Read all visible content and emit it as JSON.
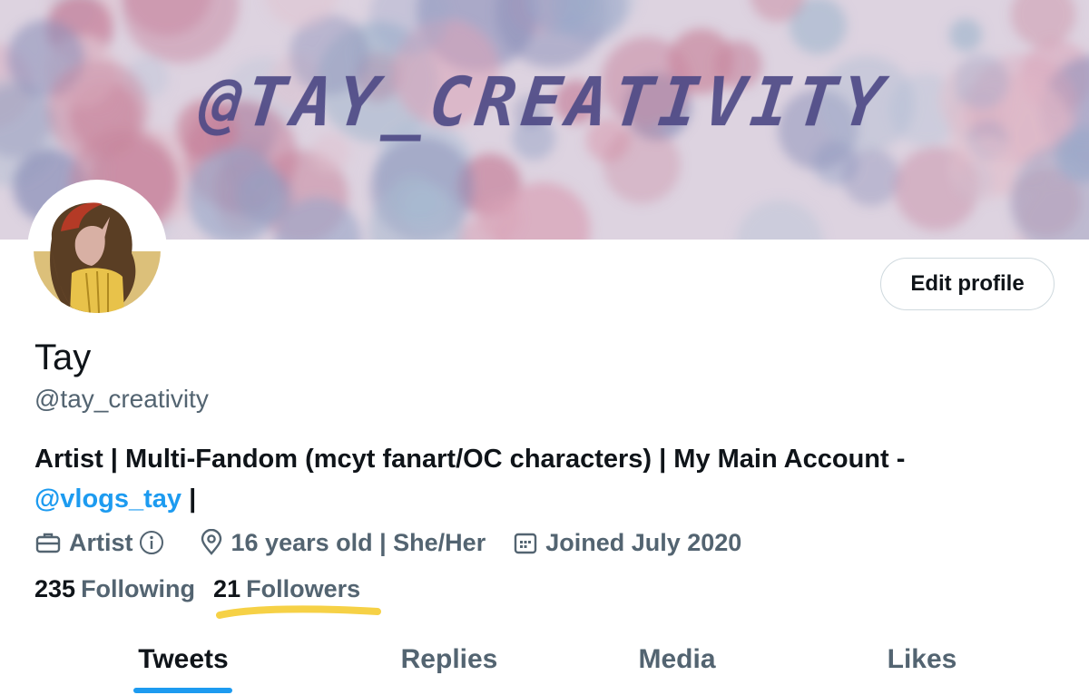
{
  "banner": {
    "title": "@TAY_CREATIVITY"
  },
  "profile": {
    "display_name": "Tay",
    "handle": "@tay_creativity",
    "edit_button": "Edit profile",
    "bio_text": "Artist | Multi-Fandom (mcyt fanart/OC characters) | My Main Account - ",
    "bio_mention": "@vlogs_tay",
    "bio_suffix": " |"
  },
  "meta": {
    "profession": "Artist",
    "location": "16 years old | She/Her",
    "joined": "Joined July 2020"
  },
  "counts": {
    "following_num": "235",
    "following_label": "Following",
    "followers_num": "21",
    "followers_label": "Followers"
  },
  "tabs": [
    {
      "label": "Tweets",
      "active": true
    },
    {
      "label": "Replies",
      "active": false
    },
    {
      "label": "Media",
      "active": false
    },
    {
      "label": "Likes",
      "active": false
    }
  ],
  "colors": {
    "accent": "#1d9bf0",
    "secondary_text": "#536471",
    "highlight": "#f6d146"
  }
}
